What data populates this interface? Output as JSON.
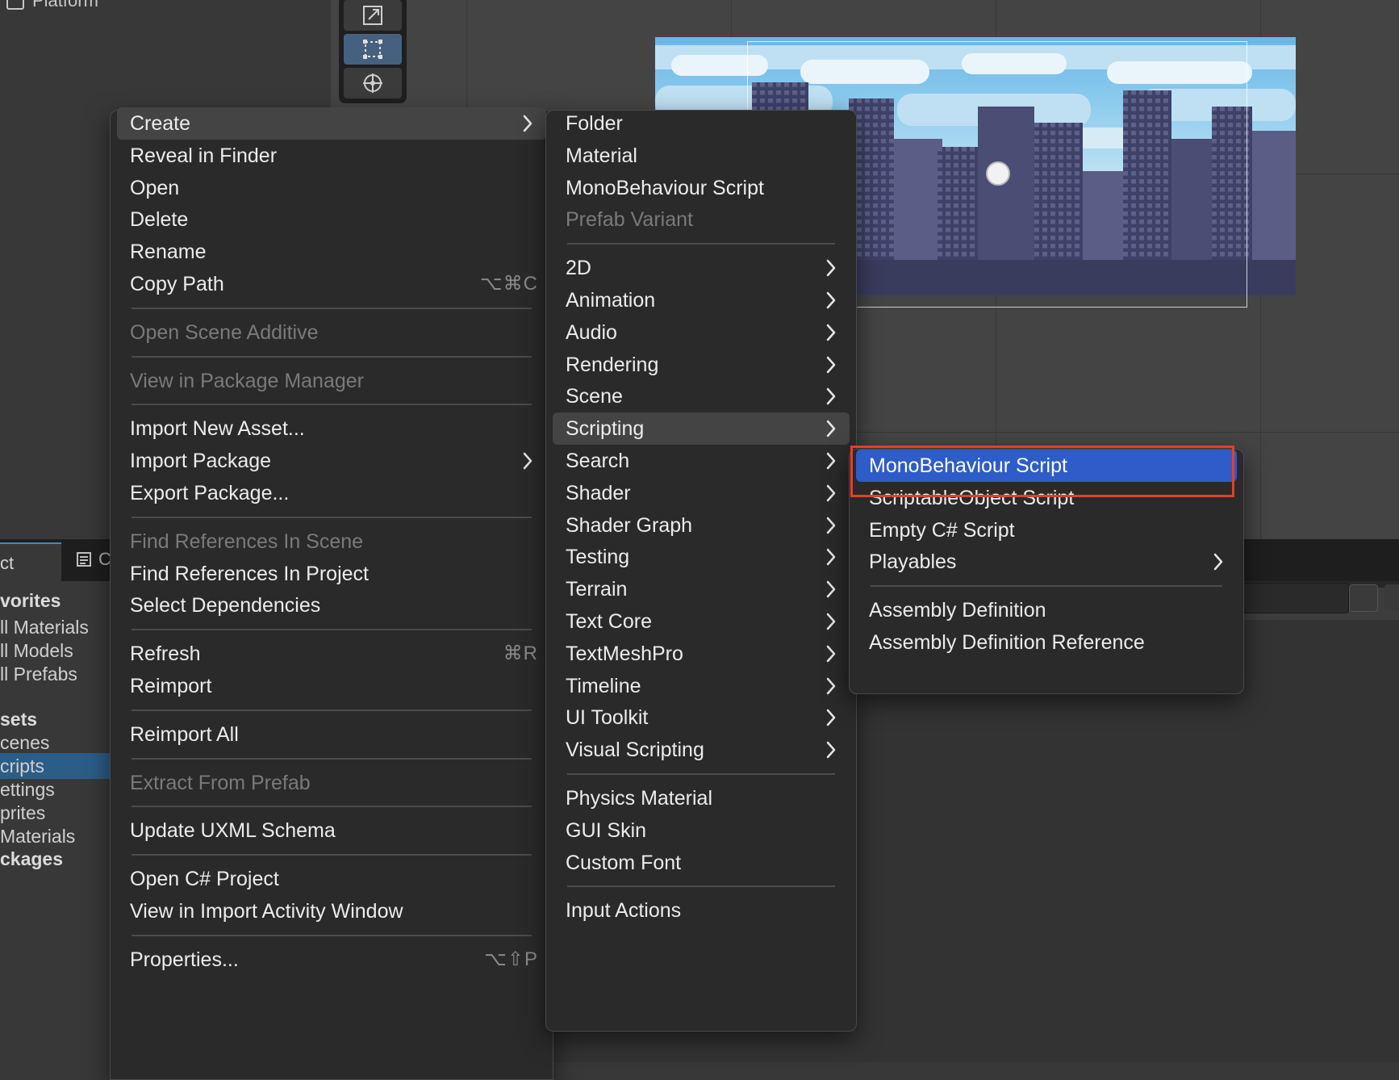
{
  "hierarchy": {
    "item_label": "Platform"
  },
  "project_panel": {
    "project_tab_label": "ct",
    "console_tab_label": "C",
    "sidebar": [
      {
        "label": "vorites",
        "kind": "head"
      },
      {
        "label": "ll Materials",
        "kind": "item"
      },
      {
        "label": "ll Models",
        "kind": "item"
      },
      {
        "label": "ll Prefabs",
        "kind": "item"
      },
      {
        "label": "sets",
        "kind": "head"
      },
      {
        "label": "cenes",
        "kind": "item"
      },
      {
        "label": "cripts",
        "kind": "selected"
      },
      {
        "label": "ettings",
        "kind": "item"
      },
      {
        "label": "prites",
        "kind": "item"
      },
      {
        "label": "Materials",
        "kind": "item"
      },
      {
        "label": "ckages",
        "kind": "head"
      }
    ]
  },
  "context_menu": {
    "items": [
      {
        "label": "Create",
        "submenu": true,
        "state": "highlighted"
      },
      {
        "label": "Reveal in Finder"
      },
      {
        "label": "Open"
      },
      {
        "label": "Delete"
      },
      {
        "label": "Rename"
      },
      {
        "label": "Copy Path",
        "shortcut": "⌥⌘C"
      },
      {
        "separator": true
      },
      {
        "label": "Open Scene Additive",
        "state": "disabled"
      },
      {
        "separator": true
      },
      {
        "label": "View in Package Manager",
        "state": "disabled"
      },
      {
        "separator": true
      },
      {
        "label": "Import New Asset..."
      },
      {
        "label": "Import Package",
        "submenu": true
      },
      {
        "label": "Export Package..."
      },
      {
        "separator": true
      },
      {
        "label": "Find References In Scene",
        "state": "disabled"
      },
      {
        "label": "Find References In Project"
      },
      {
        "label": "Select Dependencies"
      },
      {
        "separator": true
      },
      {
        "label": "Refresh",
        "shortcut": "⌘R"
      },
      {
        "label": "Reimport"
      },
      {
        "separator": true
      },
      {
        "label": "Reimport All"
      },
      {
        "separator": true
      },
      {
        "label": "Extract From Prefab",
        "state": "disabled"
      },
      {
        "separator": true
      },
      {
        "label": "Update UXML Schema"
      },
      {
        "separator": true
      },
      {
        "label": "Open C# Project"
      },
      {
        "label": "View in Import Activity Window"
      },
      {
        "separator": true
      },
      {
        "label": "Properties...",
        "shortcut": "⌥⇧P"
      }
    ]
  },
  "create_submenu": {
    "items": [
      {
        "label": "Folder"
      },
      {
        "label": "Material"
      },
      {
        "label": "MonoBehaviour Script"
      },
      {
        "label": "Prefab Variant",
        "state": "disabled"
      },
      {
        "separator": true
      },
      {
        "label": "2D",
        "submenu": true
      },
      {
        "label": "Animation",
        "submenu": true
      },
      {
        "label": "Audio",
        "submenu": true
      },
      {
        "label": "Rendering",
        "submenu": true
      },
      {
        "label": "Scene",
        "submenu": true
      },
      {
        "label": "Scripting",
        "submenu": true,
        "state": "highlighted"
      },
      {
        "label": "Search",
        "submenu": true
      },
      {
        "label": "Shader",
        "submenu": true
      },
      {
        "label": "Shader Graph",
        "submenu": true
      },
      {
        "label": "Testing",
        "submenu": true
      },
      {
        "label": "Terrain",
        "submenu": true
      },
      {
        "label": "Text Core",
        "submenu": true
      },
      {
        "label": "TextMeshPro",
        "submenu": true
      },
      {
        "label": "Timeline",
        "submenu": true
      },
      {
        "label": "UI Toolkit",
        "submenu": true
      },
      {
        "label": "Visual Scripting",
        "submenu": true
      },
      {
        "separator": true
      },
      {
        "label": "Physics Material"
      },
      {
        "label": "GUI Skin"
      },
      {
        "label": "Custom Font"
      },
      {
        "separator": true
      },
      {
        "label": "Input Actions"
      }
    ]
  },
  "scripting_submenu": {
    "items": [
      {
        "label": "MonoBehaviour Script",
        "state": "selected"
      },
      {
        "label": "ScriptableObject Script"
      },
      {
        "label": "Empty C# Script"
      },
      {
        "label": "Playables",
        "submenu": true
      },
      {
        "separator": true
      },
      {
        "label": "Assembly Definition"
      },
      {
        "label": "Assembly Definition Reference"
      }
    ]
  },
  "colors": {
    "menu_bg": "#2a2a2a",
    "menu_highlight": "#444444",
    "menu_selected": "#2e5cc8",
    "annotation_box": "#e0402b",
    "sidebar_selected": "#2c5d87"
  }
}
